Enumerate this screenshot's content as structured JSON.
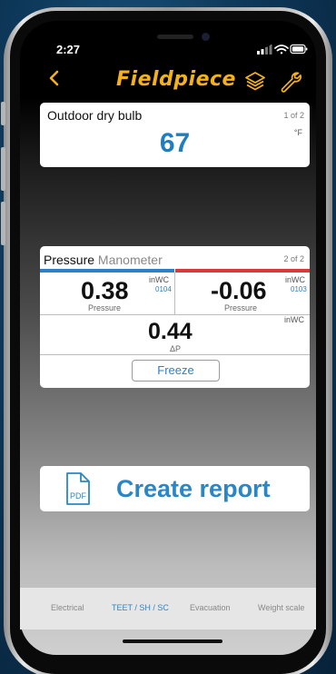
{
  "status_bar": {
    "time": "2:27"
  },
  "header": {
    "brand": "Fieldpiece",
    "back_icon": "chevron-left-icon",
    "layers_icon": "layers-icon",
    "settings_icon": "wrench-icon",
    "accent_color": "#f3b21b"
  },
  "outdoor_card": {
    "title": "Outdoor dry bulb",
    "page": "1 of 2",
    "unit": "°F",
    "value": "67",
    "value_color": "#1e7ec2"
  },
  "pressure_card": {
    "title": "Pressure",
    "subtitle": "Manometer",
    "page": "2 of 2",
    "left": {
      "value": "0.38",
      "unit": "inWC",
      "code": "0104",
      "label": "Pressure",
      "color": "#2f7fc4"
    },
    "right": {
      "value": "-0.06",
      "unit": "inWC",
      "code": "0103",
      "label": "Pressure",
      "color": "#d83a3a"
    },
    "delta": {
      "value": "0.44",
      "unit": "inWC",
      "label": "ΔP"
    },
    "freeze_label": "Freeze"
  },
  "report": {
    "label": "Create report",
    "icon": "pdf-file-icon",
    "icon_text": "PDF"
  },
  "tabs": [
    {
      "label": "Electrical",
      "active": false
    },
    {
      "label": "TEET / SH / SC",
      "active": true
    },
    {
      "label": "Evacuation",
      "active": false
    },
    {
      "label": "Weight scale",
      "active": false
    }
  ]
}
